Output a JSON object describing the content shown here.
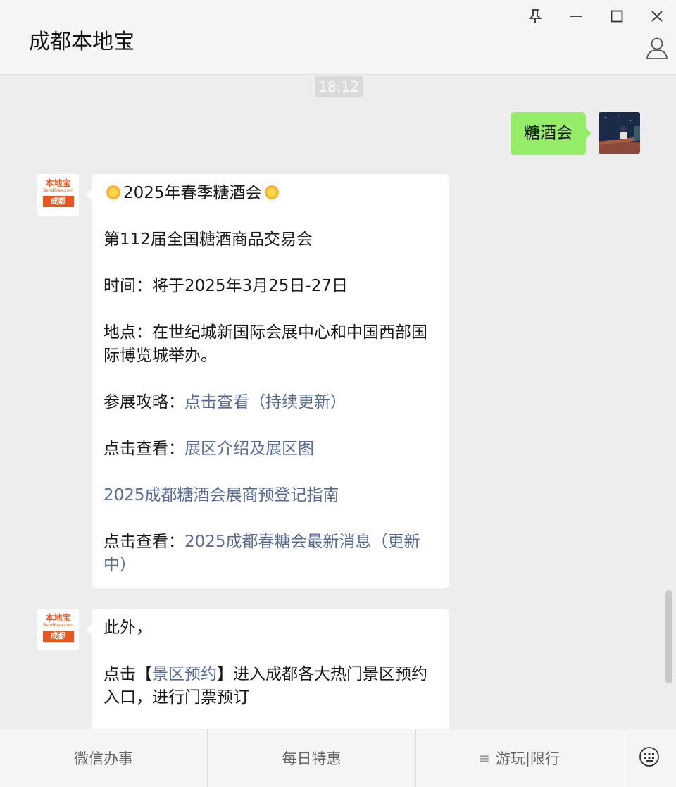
{
  "app": {
    "title": "成都本地宝"
  },
  "chat": {
    "timestamp": "18:12",
    "my_message": "糖酒会",
    "avatar_logo": {
      "top": "本地宝",
      "sub": "Bendibao.com",
      "city": "成都"
    },
    "message1": {
      "headline": "2025年春季糖酒会",
      "line_event": "第112届全国糖酒商品交易会",
      "line_time": "时间：将于2025年3月25日-27日",
      "line_place": "地点：在世纪城新国际会展中心和中国西部国际博览城举办。",
      "guide_prefix": "参展攻略：",
      "guide_link": "点击查看（持续更新）",
      "map_prefix": "点击查看：",
      "map_link": "展区介绍及展区图",
      "register_link": "2025成都糖酒会展商预登记指南",
      "news_prefix": "点击查看：",
      "news_link": "2025成都春糖会最新消息（更新中）"
    },
    "message2": {
      "intro": "此外，",
      "tip_prefix": "点击【",
      "tip_link": "景区预约",
      "tip_suffix": "】进入成都各大热门景区预约入口，进行门票预订"
    }
  },
  "menu": {
    "items": [
      "微信办事",
      "每日特惠",
      "游玩|限行"
    ],
    "keyboard_icon": "keyboard-icon"
  },
  "colors": {
    "accent_green": "#95ec69",
    "link": "#576b95",
    "brand_orange": "#e8561e"
  }
}
